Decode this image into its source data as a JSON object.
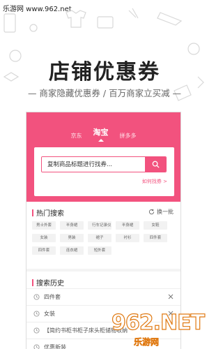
{
  "site_mark": "乐游网 www.962.net",
  "hero": {
    "title": "店铺优惠券",
    "subtitle": "— 商家隐藏优惠券 / 百万商家立买减 —"
  },
  "header": {
    "tabs": [
      {
        "label": "京东",
        "active": false
      },
      {
        "label": "淘宝",
        "active": true
      },
      {
        "label": "拼多多",
        "active": false
      }
    ]
  },
  "search": {
    "placeholder": "复制商品标题进行找券...",
    "howto_label": "如何找券 >"
  },
  "hot_search": {
    "title": "热门搜索",
    "refresh_label": "换一批",
    "tags": [
      "男士外套",
      "半身裙",
      "行车记录仪",
      "半身裙",
      "女鞋",
      "女装",
      "男装",
      "裙子",
      "衬衫",
      "四件套",
      "四件套",
      "连衣裙",
      "短外套"
    ]
  },
  "history": {
    "title": "搜索历史",
    "items": [
      "四件套",
      "女装",
      "【简约书柜书柜子床头柜储物收纳",
      "优惠新装"
    ]
  },
  "watermark": {
    "big": "962.NET",
    "small": "乐游网"
  },
  "colors": {
    "accent": "#f2527e",
    "watermark_stroke": "#e07a13"
  }
}
